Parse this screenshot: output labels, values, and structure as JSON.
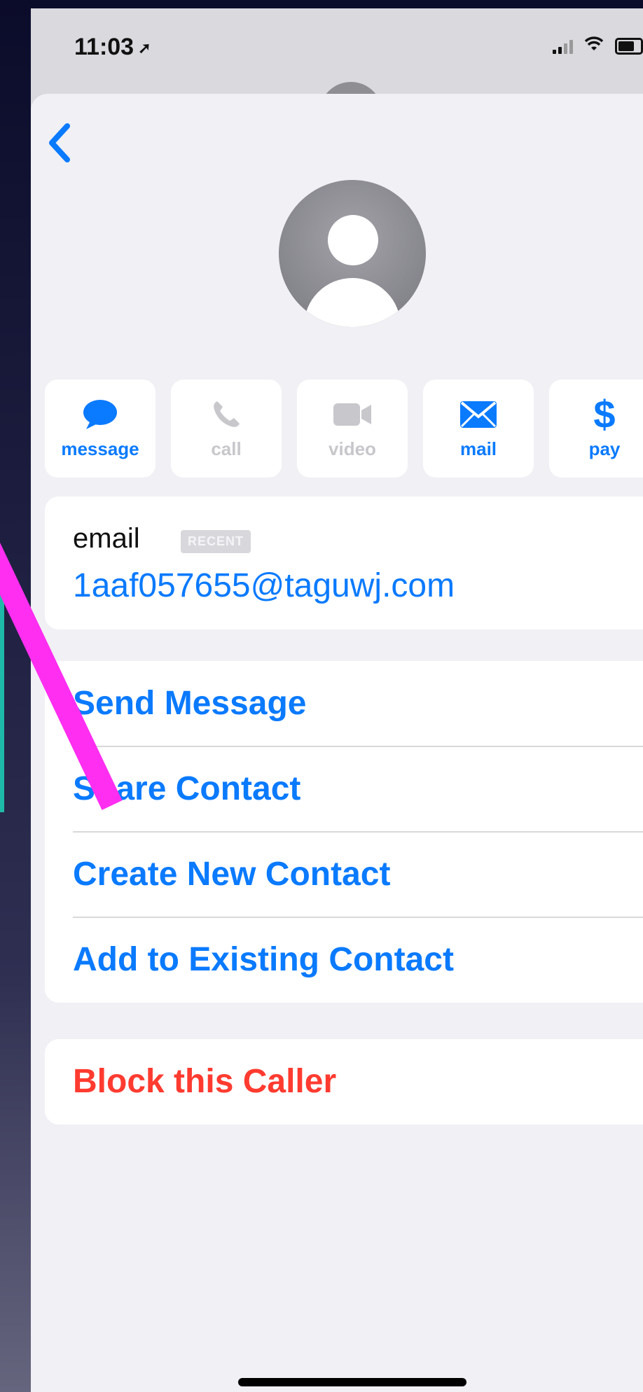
{
  "status": {
    "time": "11:03"
  },
  "icons": {
    "location": "location-arrow-icon",
    "signal": "cellular-signal-icon",
    "wifi": "wifi-icon",
    "battery": "battery-icon",
    "back": "chevron-left-icon",
    "avatar": "person-silhouette-icon",
    "message": "speech-bubble-icon",
    "call": "phone-icon",
    "video": "video-camera-icon",
    "mail": "envelope-icon",
    "pay": "dollar-icon"
  },
  "actions": [
    {
      "label": "message",
      "enabled": true
    },
    {
      "label": "call",
      "enabled": false
    },
    {
      "label": "video",
      "enabled": false
    },
    {
      "label": "mail",
      "enabled": true
    },
    {
      "label": "pay",
      "enabled": true
    }
  ],
  "email": {
    "label": "email",
    "badge": "RECENT",
    "value": "1aaf057655@taguwj.com"
  },
  "menu": [
    "Send Message",
    "Share Contact",
    "Create New Contact",
    "Add to Existing Contact"
  ],
  "block": {
    "label": "Block this Caller"
  },
  "colors": {
    "accent": "#0a7aff",
    "destructive": "#ff3b30",
    "annotation": "#ff2ef0"
  }
}
